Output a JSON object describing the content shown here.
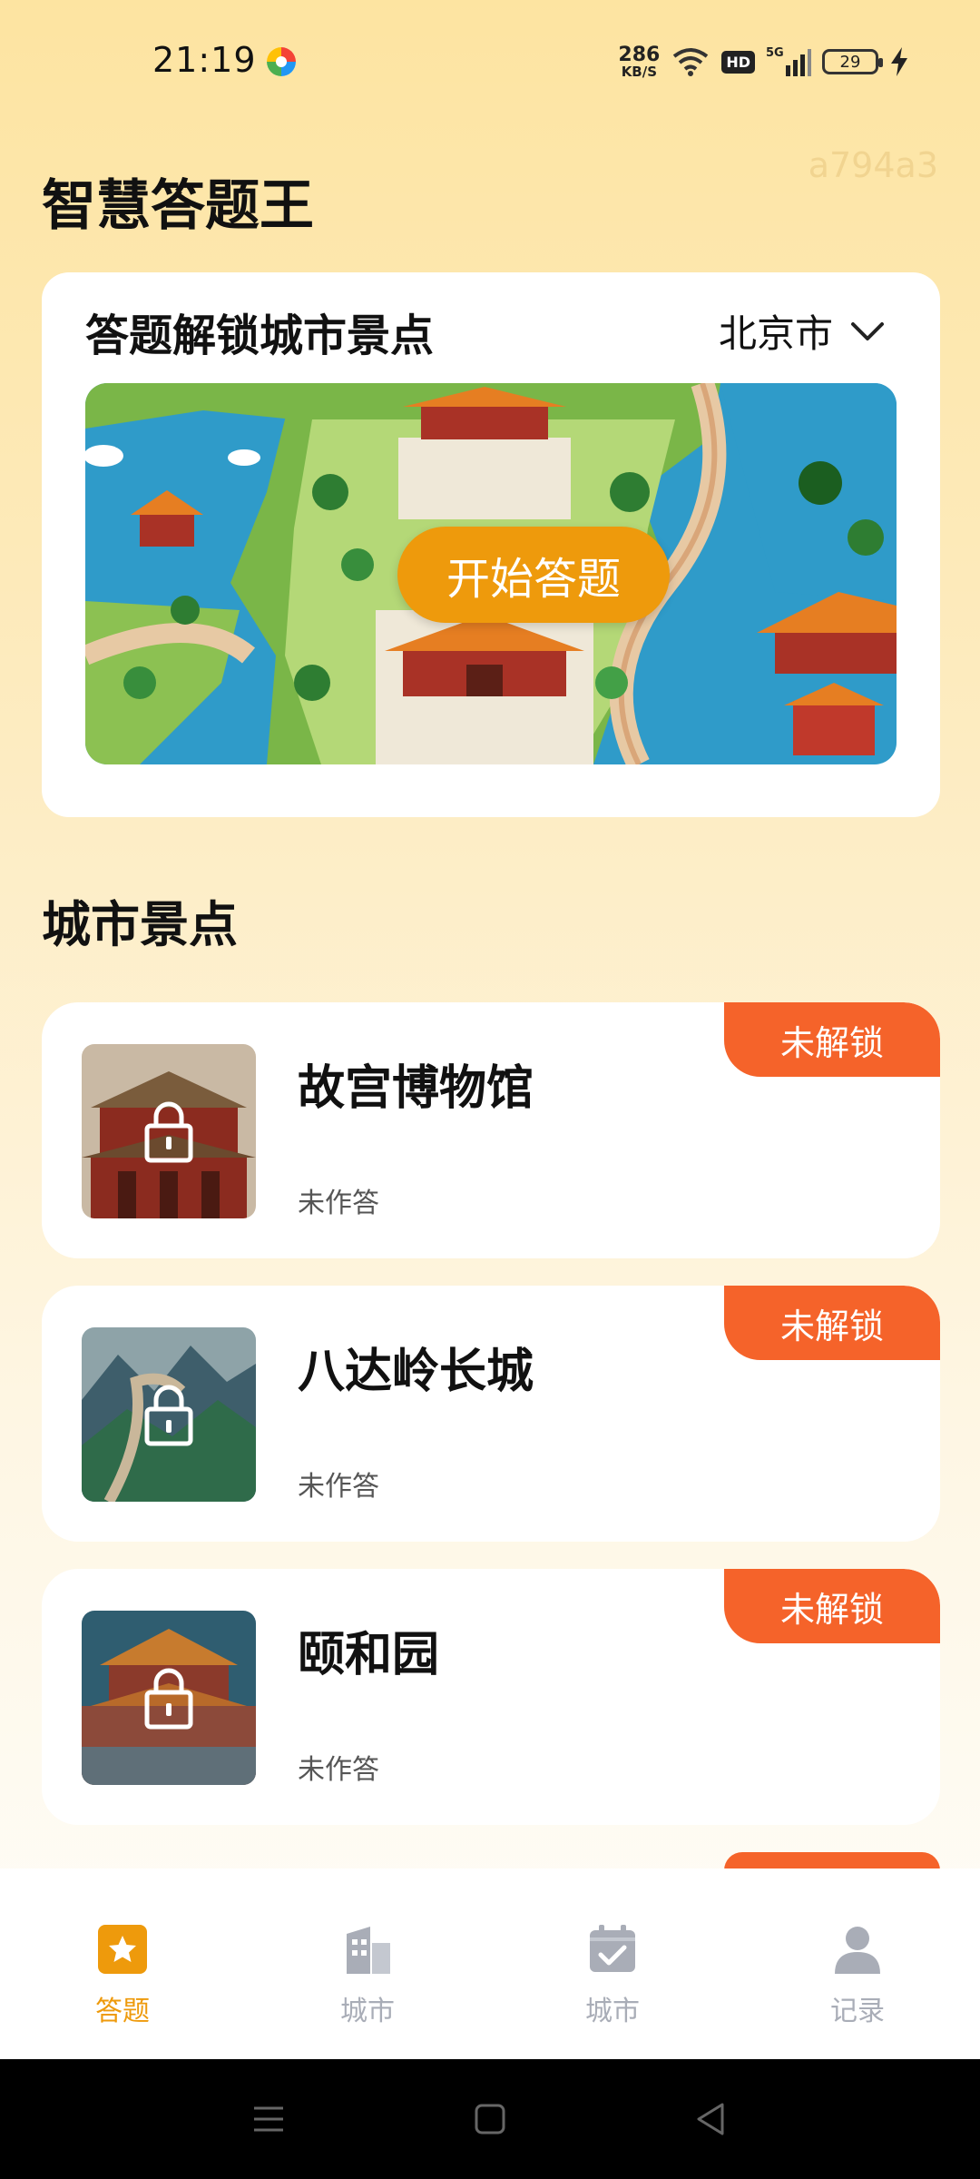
{
  "status_bar": {
    "time": "21:19",
    "net_speed_value": "286",
    "net_speed_unit": "KB/S",
    "hd": "HD",
    "signal": "5G",
    "battery": "29"
  },
  "watermark": "a794a3",
  "app_title": "智慧答题王",
  "hero": {
    "title": "答题解锁城市景点",
    "city": "北京市",
    "start_button": "开始答题"
  },
  "section_title": "城市景点",
  "spots": [
    {
      "name": "故宫博物馆",
      "status": "未作答",
      "badge": "未解锁"
    },
    {
      "name": "八达岭长城",
      "status": "未作答",
      "badge": "未解锁"
    },
    {
      "name": "颐和园",
      "status": "未作答",
      "badge": "未解锁"
    }
  ],
  "nav": [
    {
      "label": "答题",
      "icon": "star-icon",
      "active": true
    },
    {
      "label": "城市",
      "icon": "building-icon",
      "active": false
    },
    {
      "label": "城市",
      "icon": "calendar-check-icon",
      "active": false
    },
    {
      "label": "记录",
      "icon": "person-icon",
      "active": false
    }
  ],
  "colors": {
    "accent": "#ee9a0c",
    "badge": "#f5632a",
    "nav_inactive": "#a9adb7"
  }
}
